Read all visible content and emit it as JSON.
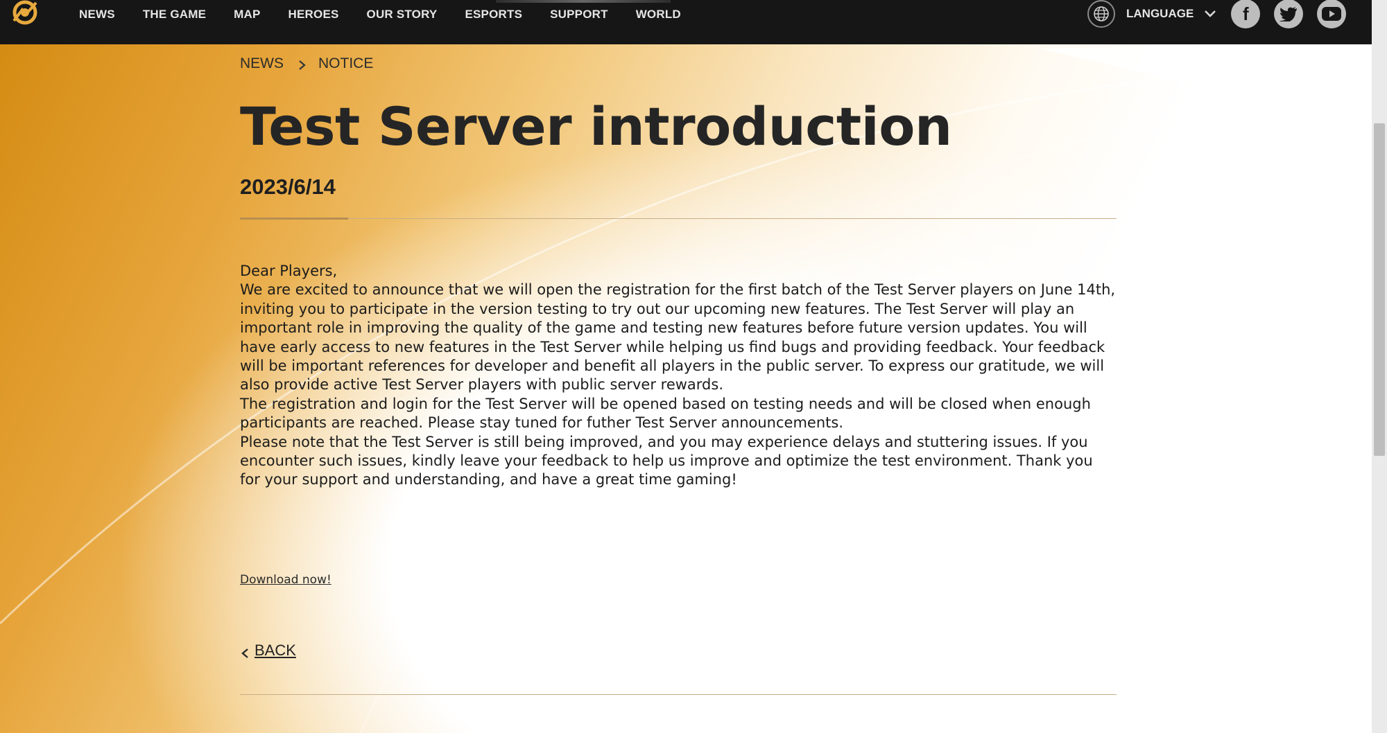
{
  "nav": {
    "items": [
      "NEWS",
      "THE GAME",
      "MAP",
      "HEROES",
      "OUR STORY",
      "ESPORTS",
      "SUPPORT",
      "WORLD"
    ],
    "language_label": "LANGUAGE",
    "social": [
      "f",
      "twitter",
      "youtube"
    ]
  },
  "icons": {
    "logo": "game-logo-icon",
    "globe": "globe-icon",
    "chevron": "chevron-down-icon",
    "facebook": "facebook-icon",
    "twitter": "twitter-icon",
    "youtube": "youtube-icon"
  },
  "breadcrumb": {
    "section": "NEWS",
    "category": "NOTICE"
  },
  "article": {
    "title": "Test Server introduction",
    "date": "2023/6/14",
    "paragraphs": [
      "Dear Players,",
      "We are excited to announce that we will open the registration for the first batch of the Test Server players on June 14th, inviting you to participate in the version testing to try out our upcoming new features. The Test Server will play an important role in improving the quality of the game and testing new features before future version updates. You will have early access to new features in the Test Server while helping us find bugs and providing feedback. Your feedback will be important references for developer and benefit all players in the public server. To express our gratitude, we will also provide active Test Server players with public server rewards.",
      "The registration and login for the Test Server will be opened based on testing needs and will be closed when enough participants are reached. Please stay tuned for futher Test Server announcements.",
      "Please note that the Test Server is still being improved, and you may experience delays and stuttering issues. If you encounter such issues, kindly leave your feedback to help us improve and optimize the test environment. Thank you for your support and understanding, and have a great time gaming!"
    ],
    "download_label": "Download now! ",
    "back_label": "BACK"
  },
  "colors": {
    "nav_bg": "#161616",
    "accent_gold": "#e6a43a",
    "rule": "#c8ad86"
  }
}
